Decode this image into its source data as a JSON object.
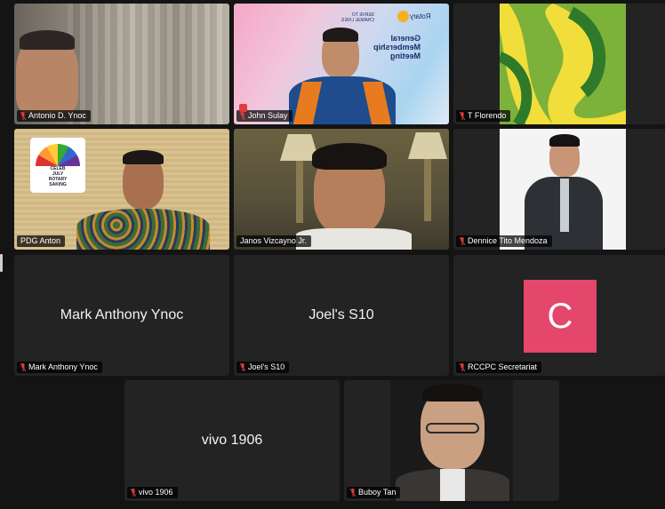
{
  "colors": {
    "background": "#141414",
    "tile": "#232323",
    "active_speaker_border": "#2ecc40",
    "avatar_bg": "#e5466b",
    "muted_mic": "#e23c3c"
  },
  "participants": [
    {
      "name": "Antonio D. Ynoc",
      "muted": true,
      "video": true
    },
    {
      "name": "John Sulay",
      "muted": true,
      "video": true,
      "has_badge": true
    },
    {
      "name": "T Florendo",
      "muted": true,
      "video": true
    },
    {
      "name": "PDG Anton",
      "muted": false,
      "video": true
    },
    {
      "name": "Janos Vizcayno Jr.",
      "muted": false,
      "video": true,
      "active_speaker": true
    },
    {
      "name": "Dennice Tito Mendoza",
      "muted": true,
      "video": true
    },
    {
      "name": "Mark Anthony Ynoc",
      "muted": true,
      "video": false,
      "display_name": "Mark Anthony Ynoc"
    },
    {
      "name": "Joel's S10",
      "muted": true,
      "video": false,
      "display_name": "Joel's S10"
    },
    {
      "name": "RCCPC Secretariat",
      "muted": true,
      "video": false,
      "avatar_letter": "C"
    },
    {
      "name": "vivo 1906",
      "muted": true,
      "video": false,
      "display_name": "vivo 1906"
    },
    {
      "name": "Buboy Tan",
      "muted": true,
      "video": true
    }
  ],
  "backdrops": {
    "john_sulay_slide": {
      "heading": "General Membership Meeting",
      "brand_1": "Rotary",
      "brand_2": "SERVE TO CHANGE LIVES"
    },
    "pdg_anton_logo": {
      "lines": [
        "CELEB",
        "JULY",
        "ROTARY",
        "SAKING"
      ]
    }
  }
}
